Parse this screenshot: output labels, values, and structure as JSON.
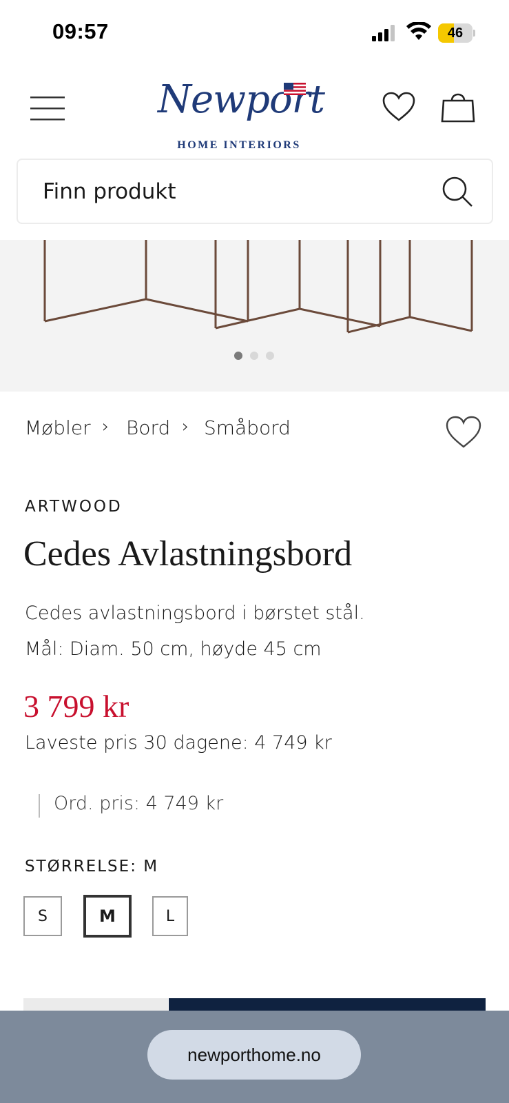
{
  "status_bar": {
    "time": "09:57",
    "battery_level": "46",
    "battery_fraction": 0.46,
    "battery_color": "#f5c800"
  },
  "header": {
    "logo_script": "Newport",
    "logo_subtitle": "HOME INTERIORS",
    "brand_color": "#1f3a78",
    "icons": [
      "menu-icon",
      "flag-icon",
      "heart-icon",
      "bag-icon"
    ]
  },
  "search": {
    "placeholder": "Finn produkt"
  },
  "gallery": {
    "dot_count": 3,
    "active_dot": 1
  },
  "breadcrumb": {
    "items": [
      "Møbler",
      "Bord",
      "Småbord"
    ],
    "separator": "›"
  },
  "product": {
    "brand": "ARTWOOD",
    "title": "Cedes Avlastningsbord",
    "description_line1": "Cedes avlastningsbord i børstet stål.",
    "description_line2": "Mål: Diam. 50 cm, høyde 45 cm",
    "price": "3 799 kr",
    "price_color": "#c8102e",
    "lowest_price": "Laveste pris 30 dagene: 4 749 kr",
    "ordinary_price": "Ord. pris: 4 749 kr"
  },
  "size": {
    "label": "STØRRELSE: M",
    "options": [
      "S",
      "M",
      "L"
    ],
    "selected": "M"
  },
  "browser": {
    "url": "newporthome.no"
  }
}
